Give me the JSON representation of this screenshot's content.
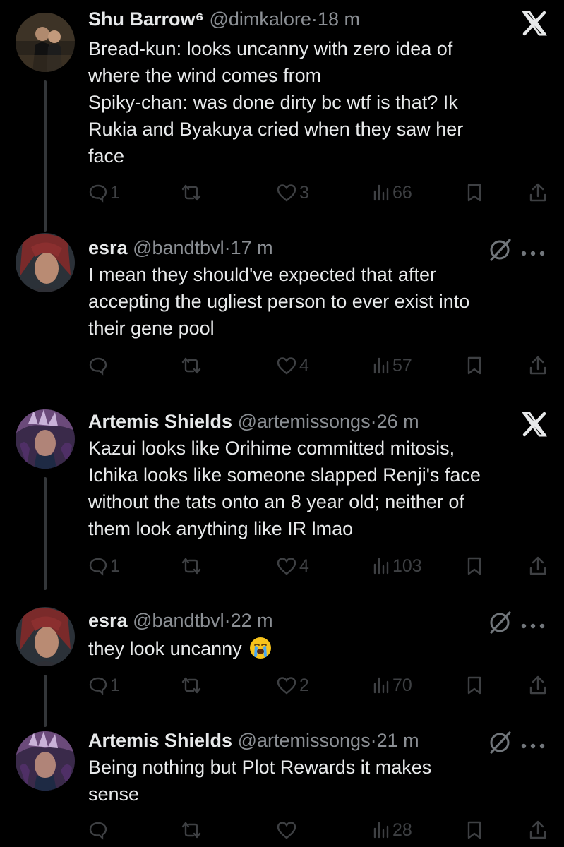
{
  "thread": [
    {
      "name": "Shu Barrow⁶",
      "handle": "@dimkalore",
      "time": "18 m",
      "top_icon": "x-close-icon",
      "text_lines": [
        "Bread-kun: looks uncanny with zero idea of",
        "where the wind comes from",
        "Spiky-chan: was done dirty bc wtf is that? Ik",
        "Rukia and Byakuya cried when they saw her",
        "face"
      ],
      "replies": "1",
      "retweets": "",
      "likes": "3",
      "views": "66"
    },
    {
      "name": "esra",
      "handle": "@bandtbvl",
      "time": "17 m",
      "top_icon": "grok-icon",
      "text_lines": [
        "I mean they should've expected that after",
        "accepting the ugliest person to ever exist into",
        "their gene pool"
      ],
      "replies": "",
      "retweets": "",
      "likes": "4",
      "views": "57"
    },
    {
      "name": "Artemis Shields",
      "handle": "@artemissongs",
      "time": "26 m",
      "top_icon": "x-close-icon",
      "text_lines": [
        "Kazui looks like Orihime committed mitosis,",
        "Ichika looks like someone slapped Renji's face",
        "without the tats onto an 8 year old; neither of",
        "them look anything like IR lmao"
      ],
      "replies": "1",
      "retweets": "",
      "likes": "4",
      "views": "103"
    },
    {
      "name": "esra",
      "handle": "@bandtbvl",
      "time": "22 m",
      "top_icon": "grok-icon",
      "text_lines": [
        "they look uncanny"
      ],
      "emoji": "loudly-crying-face-emoji",
      "replies": "1",
      "retweets": "",
      "likes": "2",
      "views": "70"
    },
    {
      "name": "Artemis Shields",
      "handle": "@artemissongs",
      "time": "21 m",
      "top_icon": "grok-icon",
      "text_lines": [
        "Being nothing but Plot Rewards it makes",
        "sense"
      ],
      "replies": "",
      "retweets": "",
      "likes": "",
      "views": "28"
    }
  ],
  "dot_separator": "·",
  "colors": {
    "background": "#000000",
    "text": "#e7e9ea",
    "muted": "#71767b"
  }
}
